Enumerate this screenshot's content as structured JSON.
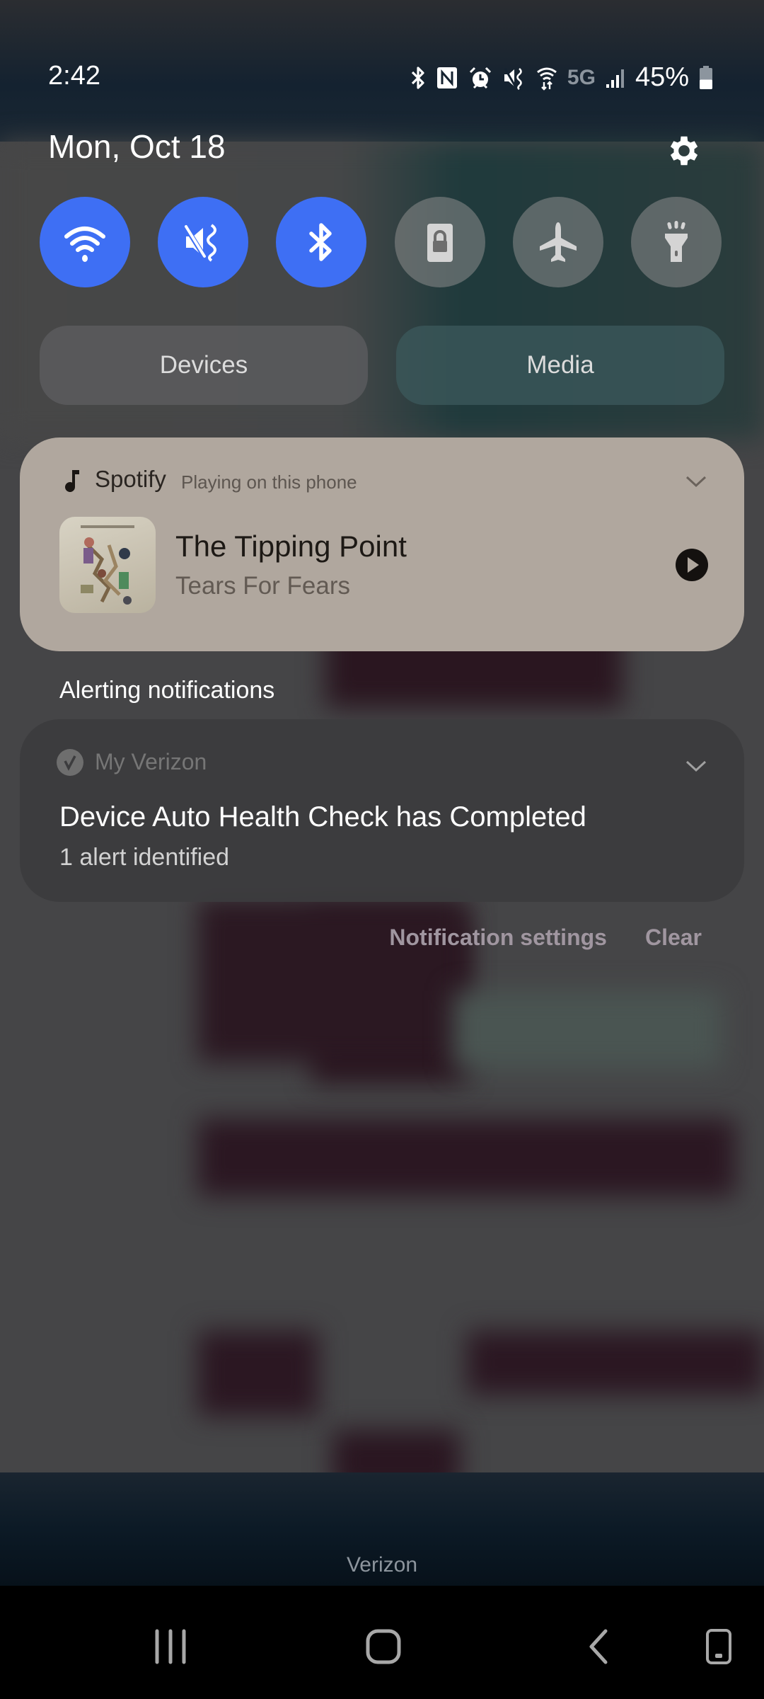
{
  "status_bar": {
    "time": "2:42",
    "icons": [
      "bluetooth-icon",
      "nfc-icon",
      "alarm-icon",
      "vibrate-icon",
      "wifi-data-icon"
    ],
    "network": "5G",
    "signal_icon": "signal-bars-icon",
    "battery_percent": "45%",
    "battery_level": 0.45
  },
  "header": {
    "date": "Mon, Oct 18",
    "settings_icon": "gear-icon"
  },
  "quick_settings": [
    {
      "name": "wifi",
      "icon": "wifi-icon",
      "active": true
    },
    {
      "name": "sound",
      "icon": "vibrate-icon",
      "active": true
    },
    {
      "name": "bluetooth",
      "icon": "bluetooth-icon",
      "active": true
    },
    {
      "name": "screen-lock",
      "icon": "rotation-lock-icon",
      "active": false
    },
    {
      "name": "airplane",
      "icon": "airplane-icon",
      "active": false
    },
    {
      "name": "flashlight",
      "icon": "flashlight-icon",
      "active": false
    }
  ],
  "pills": {
    "devices": "Devices",
    "media": "Media"
  },
  "media_player": {
    "app": "Spotify",
    "subtitle": "Playing on this phone",
    "title": "The Tipping Point",
    "artist": "Tears For Fears",
    "state": "paused"
  },
  "notifications": {
    "section_label": "Alerting notifications",
    "items": [
      {
        "app": "My Verizon",
        "title": "Device Auto Health Check has Completed",
        "text": "1 alert identified"
      }
    ],
    "settings_label": "Notification settings",
    "clear_label": "Clear"
  },
  "carrier": "Verizon",
  "colors": {
    "accent": "#3e6ff4",
    "media_card": "#b0a79e"
  }
}
